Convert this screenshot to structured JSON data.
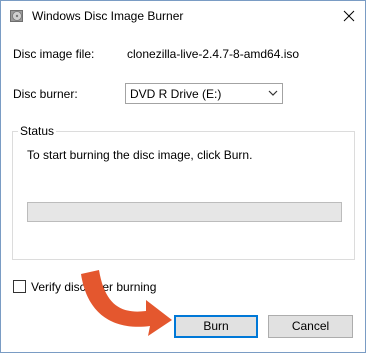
{
  "window": {
    "title": "Windows Disc Image Burner"
  },
  "form": {
    "disc_image_label": "Disc image file:",
    "disc_image_value": "clonezilla-live-2.4.7-8-amd64.iso",
    "burner_label": "Disc burner:",
    "burner_selected": "DVD R Drive (E:)"
  },
  "status": {
    "group_title": "Status",
    "message": "To start burning the disc image, click Burn.",
    "progress": 0
  },
  "verify": {
    "label": "Verify disc after burning",
    "checked": false
  },
  "buttons": {
    "burn_label": "Burn",
    "cancel_label": "Cancel"
  },
  "colors": {
    "accent": "#0078d7",
    "annotation_arrow": "#e4572e"
  },
  "icons": {
    "title": "disc-burner-icon",
    "close": "close-icon",
    "dropdown": "chevron-down-icon"
  }
}
